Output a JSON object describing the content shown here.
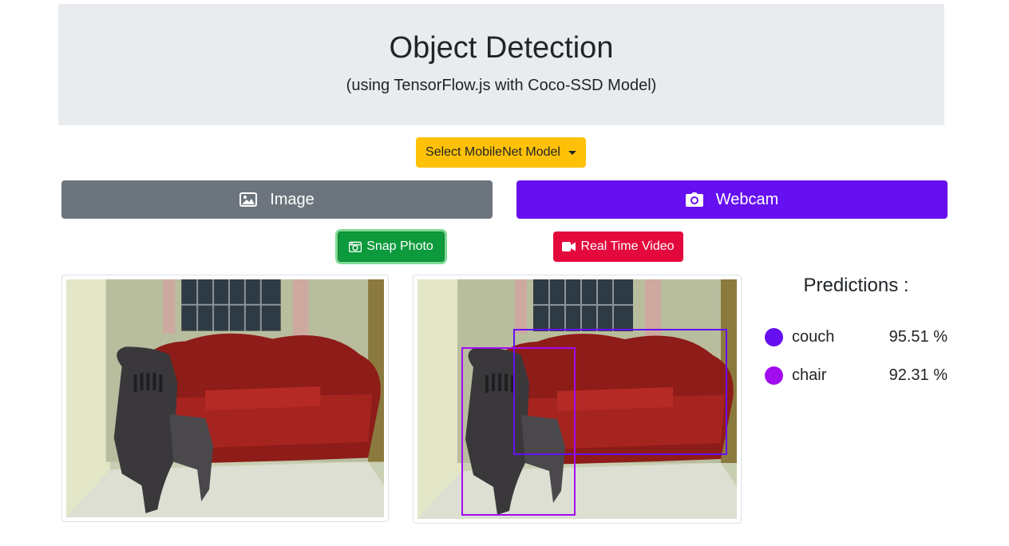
{
  "header": {
    "title": "Object Detection",
    "subtitle": "(using TensorFlow.js with Coco-SSD Model)"
  },
  "model_select": {
    "label": "Select MobileNet Model"
  },
  "mode_buttons": {
    "image_label": "Image",
    "webcam_label": "Webcam"
  },
  "actions": {
    "snap_label": "Snap Photo",
    "video_label": "Real Time Video"
  },
  "predictions": {
    "title": "Predictions :",
    "items": [
      {
        "label": "couch",
        "score": "95.51 %",
        "color": "#6610f2"
      },
      {
        "label": "chair",
        "score": "92.31 %",
        "color": "#a20cf0"
      }
    ]
  },
  "colors": {
    "warning": "#ffc107",
    "secondary": "#6c757d",
    "primary_purple": "#6610f2",
    "success": "#0d9a3c",
    "danger": "#e4093c",
    "jumbotron_bg": "#e9ecef"
  }
}
